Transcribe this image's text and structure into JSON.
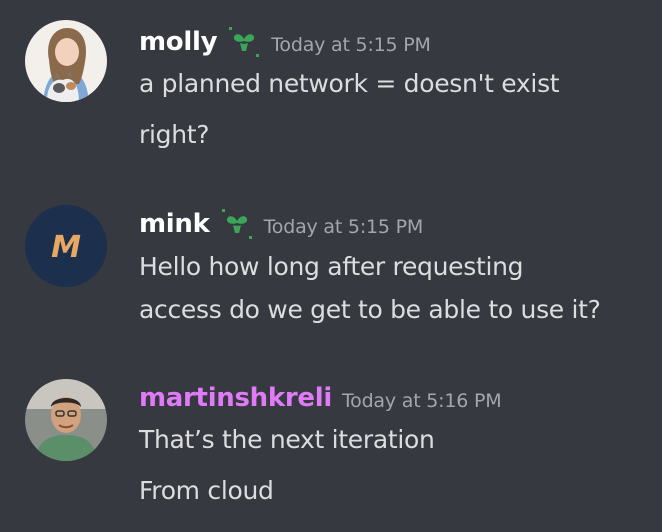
{
  "messages": [
    {
      "username": "molly",
      "username_color": "#ffffff",
      "has_badge": true,
      "timestamp": "Today at 5:15 PM",
      "avatar": "illustrated-girl-with-cat-icon",
      "lines": [
        "a planned network = doesn't exist",
        "right?"
      ]
    },
    {
      "username": "mink",
      "username_color": "#ffffff",
      "has_badge": true,
      "timestamp": "Today at 5:15 PM",
      "avatar": "letter-m-logo-icon",
      "avatar_letter": "M",
      "lines": [
        "Hello how long after requesting",
        "access do we get to be able to use it?"
      ]
    },
    {
      "username": "martinshkreli",
      "username_color": "#e17af9",
      "has_badge": false,
      "timestamp": "Today at 5:16 PM",
      "avatar": "user-photo-icon",
      "lines": [
        "That’s the next iteration",
        "From cloud"
      ]
    }
  ],
  "colors": {
    "background": "#36393f",
    "message_text": "#dcddde",
    "timestamp": "#a3a6aa",
    "badge_green": "#3ba55c"
  }
}
